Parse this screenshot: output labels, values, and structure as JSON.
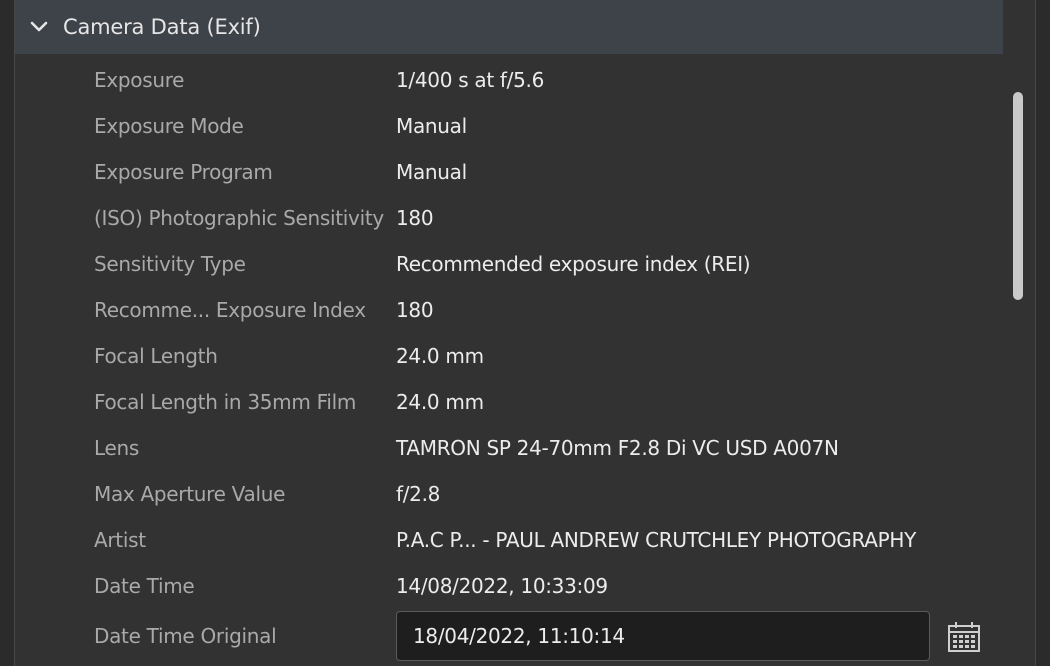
{
  "section": {
    "title": "Camera Data (Exif)",
    "expanded_icon": "chevron-down-icon"
  },
  "rows": [
    {
      "label": "Exposure",
      "value": "1/400 s at f/5.6"
    },
    {
      "label": "Exposure Mode",
      "value": "Manual"
    },
    {
      "label": "Exposure Program",
      "value": "Manual"
    },
    {
      "label": "(ISO) Photographic Sensitivity",
      "value": "180"
    },
    {
      "label": "Sensitivity Type",
      "value": "Recommended exposure index (REI)"
    },
    {
      "label": "Recomme... Exposure Index",
      "value": "180"
    },
    {
      "label": "Focal Length",
      "value": "24.0 mm"
    },
    {
      "label": "Focal Length in 35mm Film",
      "value": "24.0 mm"
    },
    {
      "label": "Lens",
      "value": "TAMRON SP 24-70mm F2.8 Di VC USD A007N"
    },
    {
      "label": "Max Aperture Value",
      "value": "f/2.8"
    },
    {
      "label": "Artist",
      "value": "P.A.C P... - PAUL ANDREW CRUTCHLEY PHOTOGRAPHY"
    },
    {
      "label": "Date Time",
      "value": "14/08/2022, 10:33:09"
    }
  ],
  "date_time_original": {
    "label": "Date Time Original",
    "value": "18/04/2022, 11:10:14",
    "picker_icon": "calendar-icon"
  },
  "colors": {
    "header_bg": "#3e4249",
    "panel_bg": "#323232",
    "label_text": "#a9a9a9",
    "value_text": "#ececec"
  }
}
